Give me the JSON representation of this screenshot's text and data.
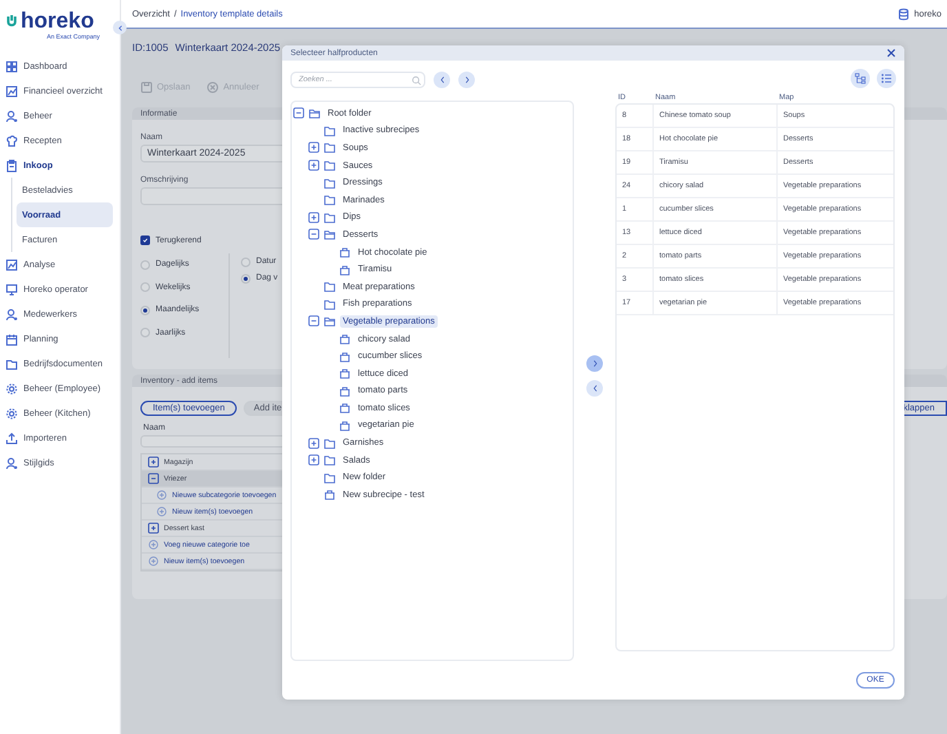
{
  "sidebar": {
    "logo": {
      "name": "horeko",
      "tagline": "An Exact Company"
    },
    "items": [
      {
        "label": "Dashboard",
        "selected": false
      },
      {
        "label": "Financieel overzicht",
        "selected": false
      },
      {
        "label": "Beheer",
        "selected": false
      },
      {
        "label": "Recepten",
        "selected": false
      },
      {
        "label": "Inkoop",
        "selected": false,
        "expanded": true,
        "children": [
          {
            "label": "Besteladvies",
            "selected": false
          },
          {
            "label": "Voorraad",
            "selected": true
          },
          {
            "label": "Facturen",
            "selected": false
          }
        ]
      },
      {
        "label": "Analyse",
        "selected": false
      },
      {
        "label": "Horeko operator",
        "selected": false
      },
      {
        "label": "Medewerkers",
        "selected": false
      },
      {
        "label": "Planning",
        "selected": false
      },
      {
        "label": "Bedrijfsdocumenten",
        "selected": false
      },
      {
        "label": "Beheer (Employee)",
        "selected": false
      },
      {
        "label": "Beheer (Kitchen)",
        "selected": false
      },
      {
        "label": "Importeren",
        "selected": false
      },
      {
        "label": "Stijlgids",
        "selected": false
      }
    ]
  },
  "breadcrumb": {
    "items": [
      "Overzicht",
      "Inventory template details"
    ],
    "separator": "/"
  },
  "account": {
    "name": "horeko"
  },
  "page": {
    "id": "ID:1005",
    "title": "Winterkaart 2024-2025",
    "toolbar": [
      {
        "label": "Opslaan",
        "kind": "save",
        "disabled": true
      },
      {
        "label": "Annuleer",
        "kind": "cancel",
        "disabled": true
      }
    ],
    "info": {
      "title": "Informatie",
      "fields": [
        {
          "label": "Naam",
          "value": "Winterkaart 2024-2025"
        },
        {
          "label": "Omschrijving"
        }
      ],
      "recurring": {
        "label": "Terugkerend",
        "checked": true
      },
      "frequency": [
        {
          "label": "Dagelijks",
          "selected": false
        },
        {
          "label": "Wekelijks",
          "selected": false
        },
        {
          "label": "Maandelijks",
          "selected": true
        },
        {
          "label": "Jaarlijks",
          "selected": false
        }
      ],
      "mode": [
        {
          "label": "Datur",
          "selected": false
        },
        {
          "label": "Dag v",
          "selected": true
        }
      ]
    },
    "inventory": {
      "title": "Inventory - add items",
      "add_button": "Item(s) toevoegen",
      "second_button": "Add ite",
      "right_button": "klappen",
      "column": "Naam",
      "rows": [
        {
          "label": "Magazijn",
          "kind": "category",
          "expanded": false,
          "selected": false
        },
        {
          "label": "Vriezer",
          "kind": "category",
          "expanded": true,
          "selected": true,
          "children": [
            {
              "label": "Nieuwe subcategorie toevoegen",
              "kind": "action"
            },
            {
              "label": "Nieuw item(s) toevoegen",
              "kind": "action"
            }
          ]
        },
        {
          "label": "Dessert kast",
          "kind": "category",
          "expanded": false,
          "selected": false
        },
        {
          "label": "Voeg nieuwe categorie toe",
          "kind": "action"
        },
        {
          "label": "Nieuw item(s) toevoegen",
          "kind": "action"
        }
      ]
    }
  },
  "dialog": {
    "title": "Selecteer halfproducten",
    "search": {
      "placeholder": "Zoeken ..."
    },
    "tree": [
      {
        "label": "Root folder",
        "kind": "folder",
        "expanded": true,
        "selected": false,
        "children": [
          {
            "label": "Inactive subrecipes",
            "kind": "folder",
            "selected": false
          },
          {
            "label": "Soups",
            "kind": "folder",
            "expanded": false,
            "selected": false
          },
          {
            "label": "Sauces",
            "kind": "folder",
            "expanded": false,
            "selected": false
          },
          {
            "label": "Dressings",
            "kind": "folder",
            "selected": false
          },
          {
            "label": "Marinades",
            "kind": "folder",
            "selected": false
          },
          {
            "label": "Dips",
            "kind": "folder",
            "expanded": false,
            "selected": false
          },
          {
            "label": "Desserts",
            "kind": "folder",
            "expanded": true,
            "selected": false,
            "children": [
              {
                "label": "Hot chocolate pie",
                "kind": "recipe",
                "selected": false
              },
              {
                "label": "Tiramisu",
                "kind": "recipe",
                "selected": false
              }
            ]
          },
          {
            "label": "Meat preparations",
            "kind": "folder",
            "selected": false
          },
          {
            "label": "Fish preparations",
            "kind": "folder",
            "selected": false
          },
          {
            "label": "Vegetable preparations",
            "kind": "folder",
            "expanded": true,
            "selected": true,
            "children": [
              {
                "label": "chicory salad",
                "kind": "recipe",
                "selected": false
              },
              {
                "label": "cucumber slices",
                "kind": "recipe",
                "selected": false
              },
              {
                "label": "lettuce diced",
                "kind": "recipe",
                "selected": false
              },
              {
                "label": "tomato parts",
                "kind": "recipe",
                "selected": false
              },
              {
                "label": "tomato slices",
                "kind": "recipe",
                "selected": false
              },
              {
                "label": "vegetarian pie",
                "kind": "recipe",
                "selected": false
              }
            ]
          },
          {
            "label": "Garnishes",
            "kind": "folder",
            "expanded": false,
            "selected": false
          },
          {
            "label": "Salads",
            "kind": "folder",
            "expanded": false,
            "selected": false
          },
          {
            "label": "New folder",
            "kind": "folder",
            "selected": false
          },
          {
            "label": "New subrecipe - test",
            "kind": "recipe",
            "selected": false
          }
        ]
      }
    ],
    "table": {
      "columns": [
        "ID",
        "Naam",
        "Map"
      ],
      "rows": [
        [
          "8",
          "Chinese tomato soup",
          "Soups"
        ],
        [
          "18",
          "Hot chocolate pie",
          "Desserts"
        ],
        [
          "19",
          "Tiramisu",
          "Desserts"
        ],
        [
          "24",
          "chicory salad",
          "Vegetable preparations"
        ],
        [
          "1",
          "cucumber slices",
          "Vegetable preparations"
        ],
        [
          "13",
          "lettuce diced",
          "Vegetable preparations"
        ],
        [
          "2",
          "tomato parts",
          "Vegetable preparations"
        ],
        [
          "3",
          "tomato slices",
          "Vegetable preparations"
        ],
        [
          "17",
          "vegetarian pie",
          "Vegetable preparations"
        ]
      ]
    },
    "ok_button": "OKE"
  }
}
